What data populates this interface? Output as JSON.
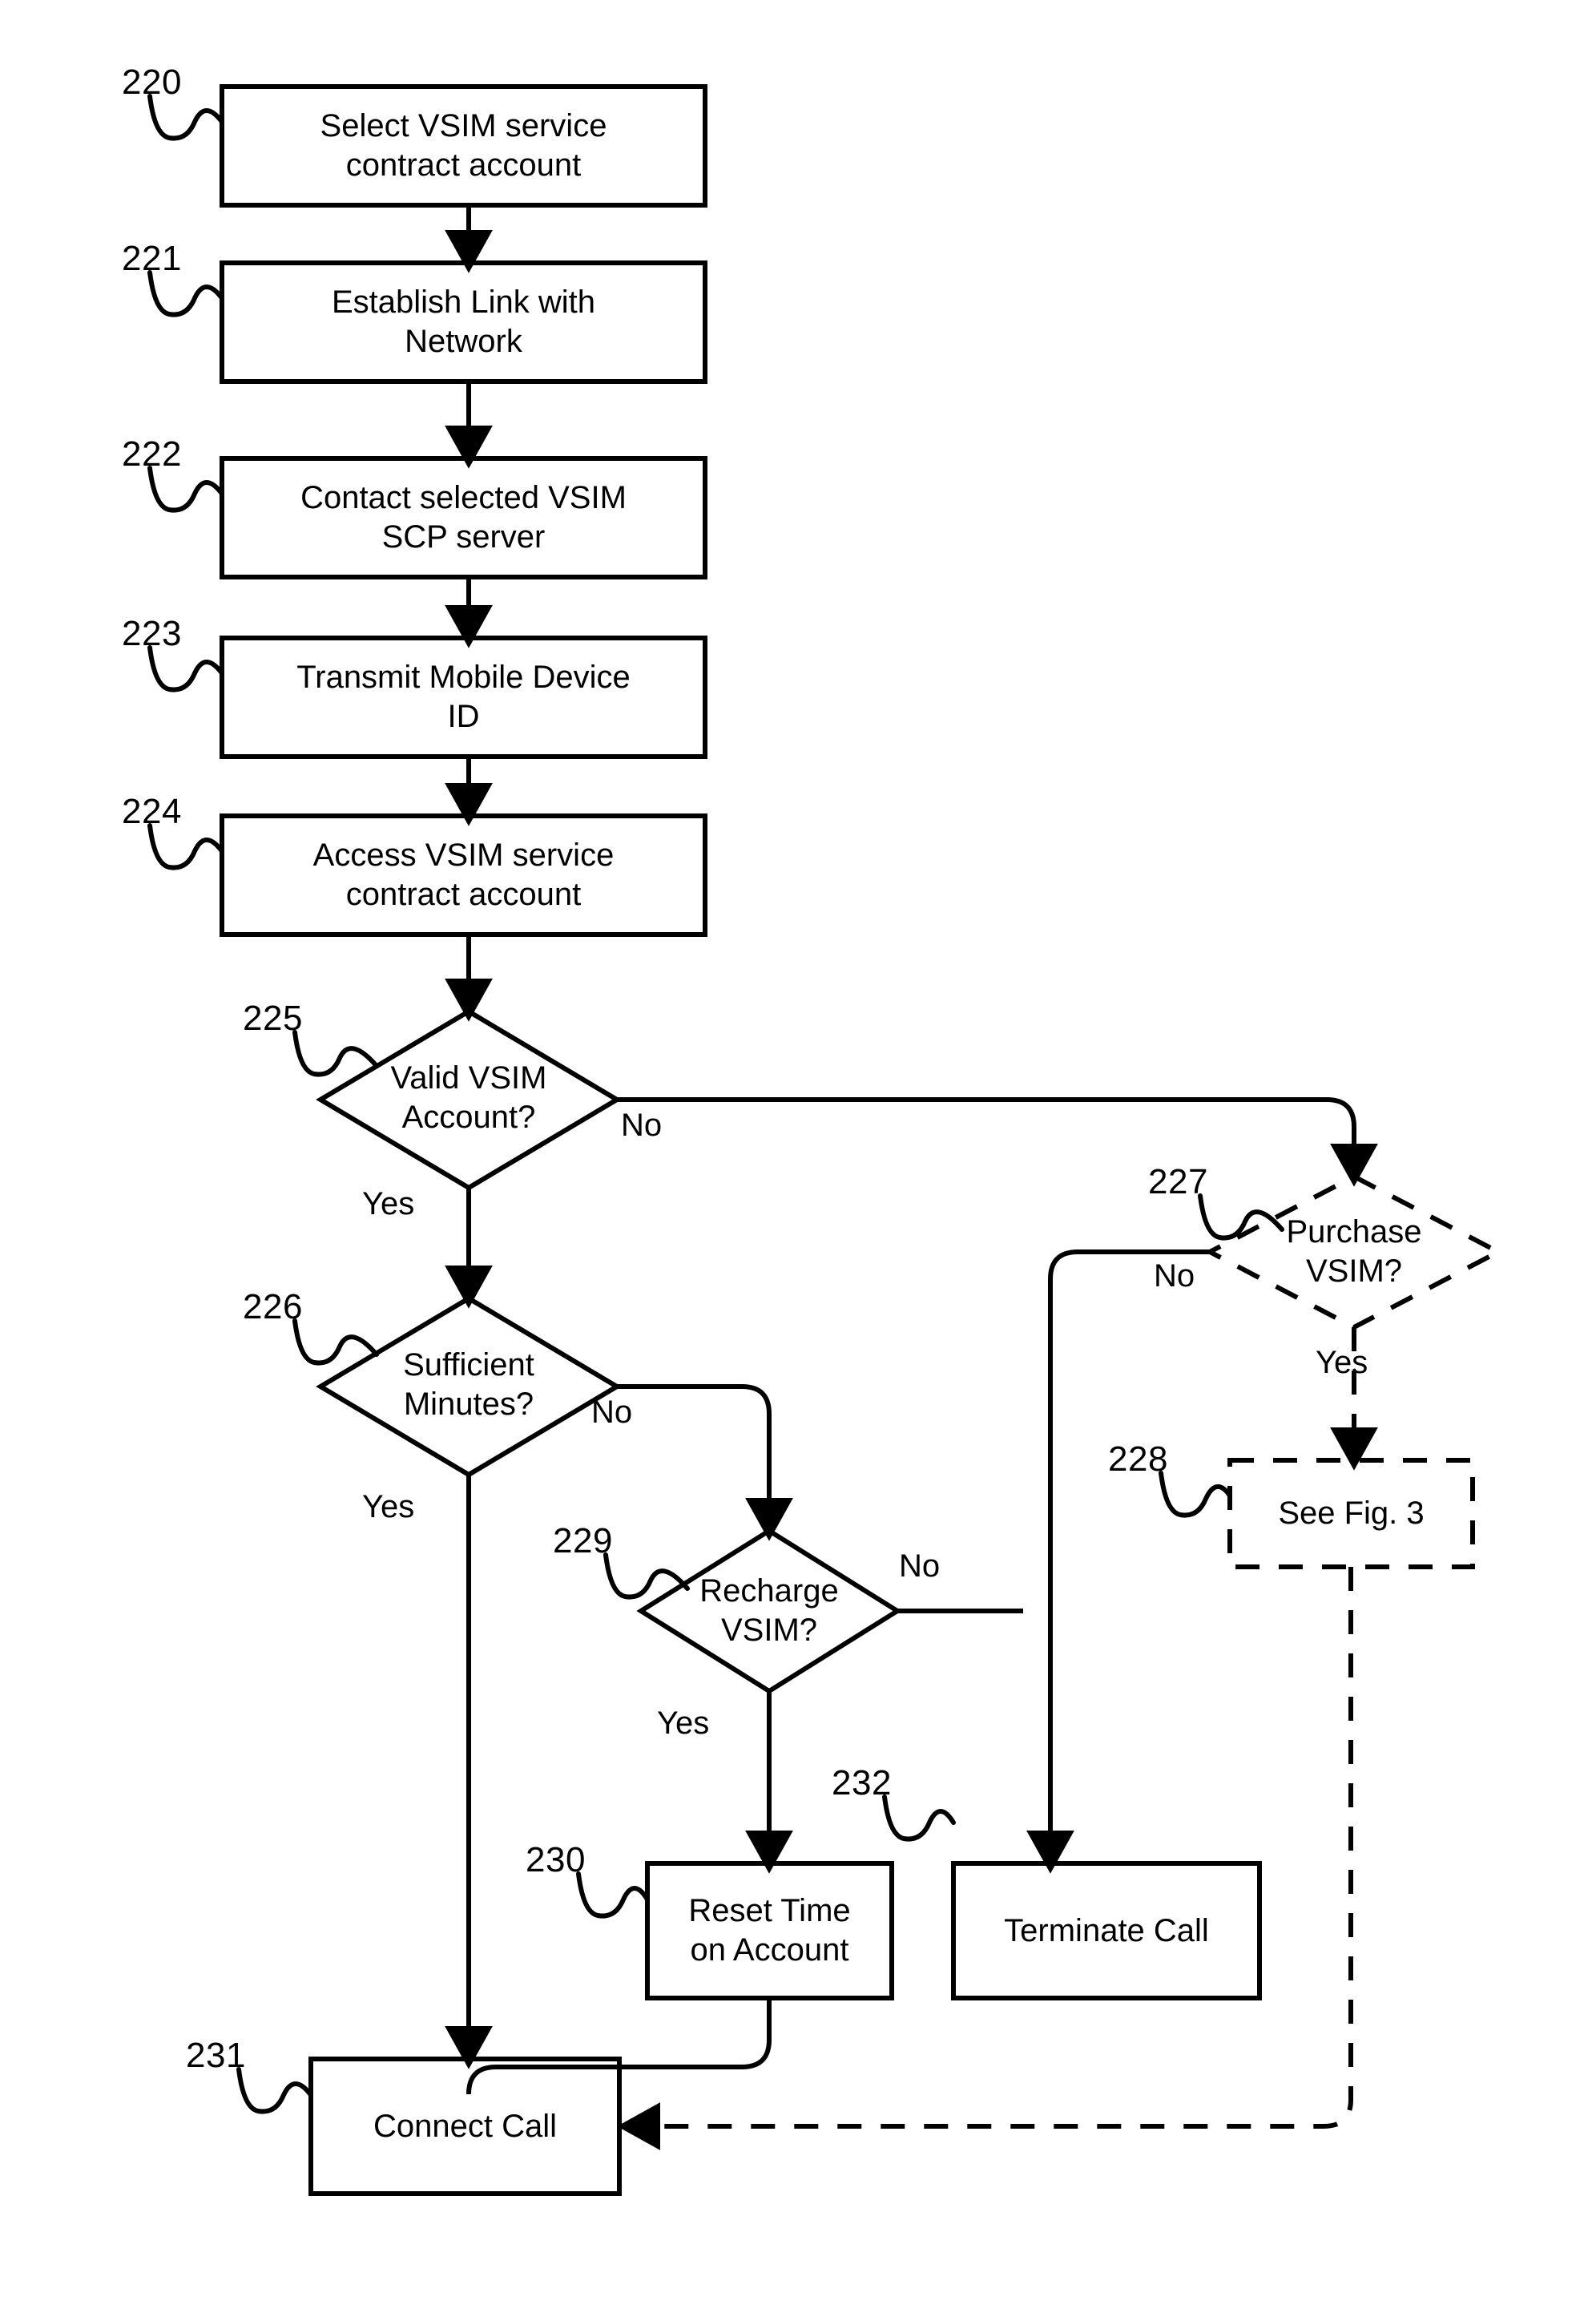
{
  "figure": {
    "title": "VSIM service contract call flow",
    "type": "patent-flowchart"
  },
  "nodes": [
    {
      "id": "220",
      "ref": "220",
      "shape": "process",
      "text": "Select VSIM service\ncontract account"
    },
    {
      "id": "221",
      "ref": "221",
      "shape": "process",
      "text": "Establish Link with\nNetwork"
    },
    {
      "id": "222",
      "ref": "222",
      "shape": "process",
      "text": "Contact selected VSIM\nSCP server"
    },
    {
      "id": "223",
      "ref": "223",
      "shape": "process",
      "text": "Transmit Mobile Device\nID"
    },
    {
      "id": "224",
      "ref": "224",
      "shape": "process",
      "text": "Access VSIM service\ncontract account"
    },
    {
      "id": "225",
      "ref": "225",
      "shape": "decision",
      "text": "Valid VSIM\nAccount?"
    },
    {
      "id": "226",
      "ref": "226",
      "shape": "decision",
      "text": "Sufficient\nMinutes?"
    },
    {
      "id": "227",
      "ref": "227",
      "shape": "decision-dashed",
      "text": "Purchase\nVSIM?"
    },
    {
      "id": "228",
      "ref": "228",
      "shape": "process-dashed",
      "text": "See Fig. 3"
    },
    {
      "id": "229",
      "ref": "229",
      "shape": "decision",
      "text": "Recharge\nVSIM?"
    },
    {
      "id": "230",
      "ref": "230",
      "shape": "process",
      "text": "Reset Time\non Account"
    },
    {
      "id": "231",
      "ref": "231",
      "shape": "process",
      "text": "Connect Call"
    },
    {
      "id": "232",
      "ref": "232",
      "shape": "process",
      "text": "Terminate Call"
    }
  ],
  "edge_labels": {
    "valid_no": "No",
    "valid_yes": "Yes",
    "sufficient_no": "No",
    "sufficient_yes": "Yes",
    "purchase_no": "No",
    "purchase_yes": "Yes",
    "recharge_no": "No",
    "recharge_yes": "Yes"
  },
  "colors": {
    "stroke": "#000000",
    "background": "#ffffff"
  }
}
